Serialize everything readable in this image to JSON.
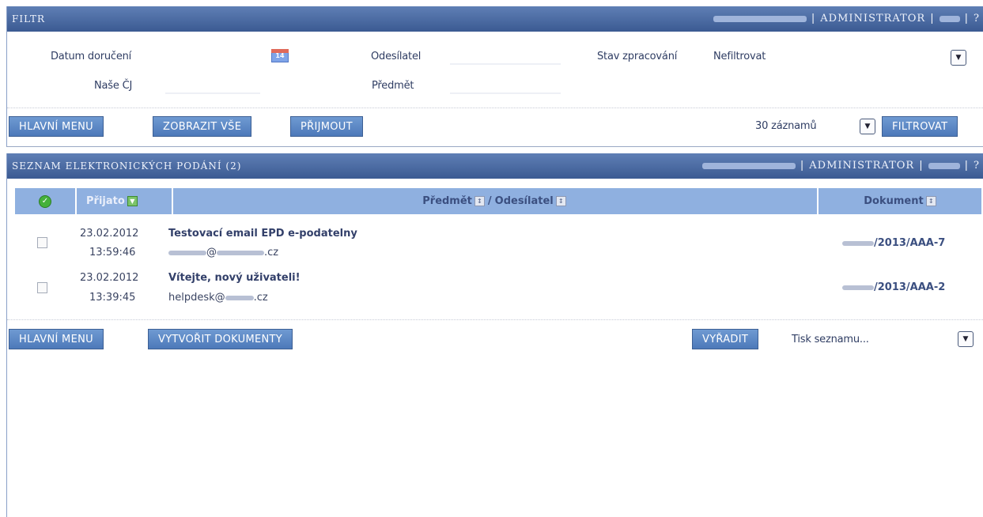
{
  "filter_panel": {
    "title": "FILTR",
    "header_role": "ADMINISTRATOR",
    "separator": "|",
    "help_char": "?",
    "fields": {
      "datum_doruceni": "Datum doručení",
      "odesilatel": "Odesílatel",
      "stav_zpracovani": "Stav zpracování",
      "stav_value": "Nefiltrovat",
      "nase_cj": "Naše ČJ",
      "predmet": "Předmět"
    },
    "calendar_icon_text": "14",
    "buttons": {
      "hlavni_menu": "HLAVNÍ MENU",
      "zobrazit_vse": "ZOBRAZIT VŠE",
      "prijmout": "PŘIJMOUT",
      "filtrovat": "FILTROVAT"
    },
    "record_count": "30 záznamů"
  },
  "list_panel": {
    "title": "SEZNAM ELEKTRONICKÝCH PODÁNÍ (2)",
    "header_role": "ADMINISTRATOR",
    "separator": "|",
    "help_char": "?",
    "columns": {
      "prijato": "Přijato",
      "predmet": "Předmět",
      "slash": "/",
      "odesilatel": "Odesílatel",
      "dokument": "Dokument"
    },
    "rows": [
      {
        "date": "23.02.2012",
        "time": "13:59:46",
        "subject": "Testovací email EPD e-podatelny",
        "sender_suffix": ".cz",
        "sender_at": "@",
        "document": "/2013/AAA-7"
      },
      {
        "date": "23.02.2012",
        "time": "13:39:45",
        "subject": "Vítejte, nový uživateli!",
        "sender_prefix": "helpdesk@",
        "sender_suffix": ".cz",
        "document": "/2013/AAA-2"
      }
    ],
    "buttons": {
      "hlavni_menu": "HLAVNÍ MENU",
      "vytvorit_dokumenty": "VYTVOŘIT DOKUMENTY",
      "vyradit": "VYŘADIT"
    },
    "print_select": "Tisk seznamu..."
  },
  "icons": {
    "calendar": "calendar-icon",
    "dropdown": "chevron-down-icon",
    "sort": "sort-icon",
    "check_all": "check-all-icon"
  },
  "colors": {
    "titlebar": "#3b5a92",
    "button": "#5a86c4",
    "table_header": "#8fb0e0",
    "check_green": "#45b13b"
  }
}
